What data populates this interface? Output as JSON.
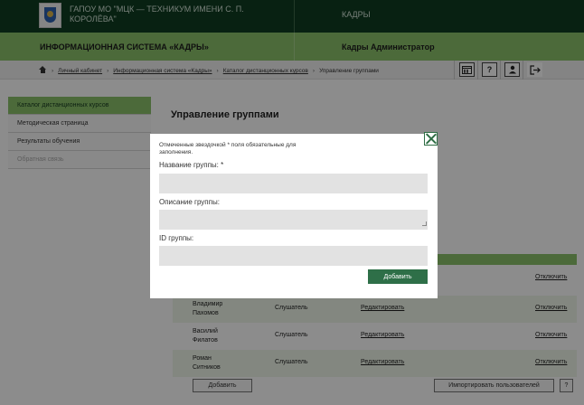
{
  "header": {
    "org_name": "ГАПОУ МО \"МЦК — ТЕХНИКУМ ИМЕНИ С. П. КОРОЛЁВА\"",
    "section": "КАДРЫ",
    "system_name": "ИНФОРМАЦИОННАЯ СИСТЕМА «КАДРЫ»",
    "user": "Кадры Администратор"
  },
  "breadcrumbs": [
    "Личный кабинет",
    "Информационная система «Кадры»",
    "Каталог дистанционных курсов",
    "Управление группами"
  ],
  "toolbar": {
    "calendar_icon": "calendar-icon",
    "help_icon": "help-icon",
    "profile_icon": "user-icon",
    "exit_icon": "exit-icon",
    "help_glyph": "?"
  },
  "sidebar": {
    "items": [
      {
        "label": "Каталог дистанционных курсов",
        "active": true
      },
      {
        "label": "Методическая страница",
        "active": false
      },
      {
        "label": "Результаты обучения",
        "active": false
      },
      {
        "label": "Обратная связь",
        "active": false
      }
    ]
  },
  "main": {
    "title": "Управление группами"
  },
  "table": {
    "rows": [
      {
        "name": "",
        "role": "",
        "edit": "",
        "off": "Отключить"
      },
      {
        "name": "Владимир Пахомов",
        "role": "Слушатель",
        "edit": "Редактировать",
        "off": "Отключить"
      },
      {
        "name": "Василий Филатов",
        "role": "Слушатель",
        "edit": "Редактировать",
        "off": "Отключить"
      },
      {
        "name": "Роман Ситников",
        "role": "Слушатель",
        "edit": "Редактировать",
        "off": "Отключить"
      }
    ],
    "add_button": "Добавить",
    "import_button": "Импортировать пользователей",
    "help_button": "?"
  },
  "modal": {
    "note": "Отмеченные звездочкой * поля обязательные для заполнения.",
    "name_label": "Название группы: *",
    "name_value": "",
    "description_label": "Описание группы:",
    "description_value": "",
    "id_label": "ID группы:",
    "id_value": "",
    "submit_label": "Добавить"
  },
  "colors": {
    "top_bar": "#0f3d21",
    "accent_green": "#8bc26a",
    "button_green": "#2e6f48"
  }
}
